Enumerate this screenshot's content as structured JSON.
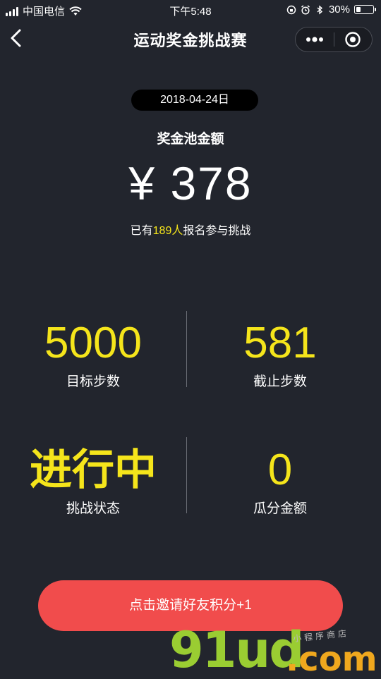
{
  "status_bar": {
    "carrier": "中国电信",
    "time": "下午5:48",
    "battery_percent": "30%",
    "battery_level": 0.3
  },
  "nav": {
    "title": "运动奖金挑战赛"
  },
  "challenge": {
    "date": "2018-04-24日",
    "pool_label": "奖金池金额",
    "pool_amount": "¥ 378",
    "participants_prefix": "已有",
    "participants_count": "189人",
    "participants_suffix": "报名参与挑战"
  },
  "stats": {
    "target_steps_value": "5000",
    "target_steps_label": "目标步数",
    "cutoff_steps_value": "581",
    "cutoff_steps_label": "截止步数",
    "status_value": "进行中",
    "status_label": "挑战状态",
    "share_amount_value": "0",
    "share_amount_label": "瓜分金额"
  },
  "actions": {
    "invite_label": "点击邀请好友积分+1"
  },
  "watermark": {
    "logo": "91ud",
    "domain": ".com",
    "side_text": "小程序商店"
  },
  "colors": {
    "background": "#22252d",
    "highlight": "#f5e51b",
    "button": "#f14c4c"
  }
}
